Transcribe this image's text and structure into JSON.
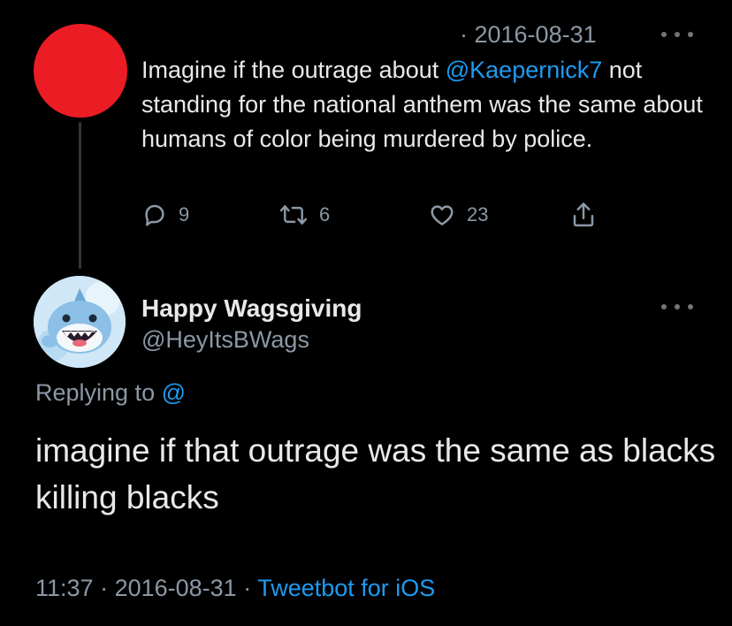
{
  "parent_tweet": {
    "date": "· 2016-08-31",
    "text_before": "Imagine if the outrage about ",
    "mention": "@Kaepernick7",
    "text_after": " not standing for the national anthem was the same about humans of color being murdered by police.",
    "actions": {
      "replies": "9",
      "retweets": "6",
      "likes": "23"
    },
    "avatar_color": "#ec1c24"
  },
  "reply_tweet": {
    "display_name": "Happy Wagsgiving",
    "handle": "@HeyItsBWags",
    "replying_label": "Replying to ",
    "replying_mention": "@",
    "text": "imagine if that outrage was the same as blacks killing blacks",
    "time": "11:37",
    "sep1": " · ",
    "date": "2016-08-31",
    "sep2": " · ",
    "client": "Tweetbot for iOS"
  },
  "colors": {
    "background": "#000000",
    "text": "#e7e9ea",
    "secondary": "#8b98a5",
    "link": "#1d9bf0"
  },
  "icons": [
    "more-icon",
    "reply-icon",
    "retweet-icon",
    "like-icon",
    "share-icon",
    "avatar-shark"
  ]
}
